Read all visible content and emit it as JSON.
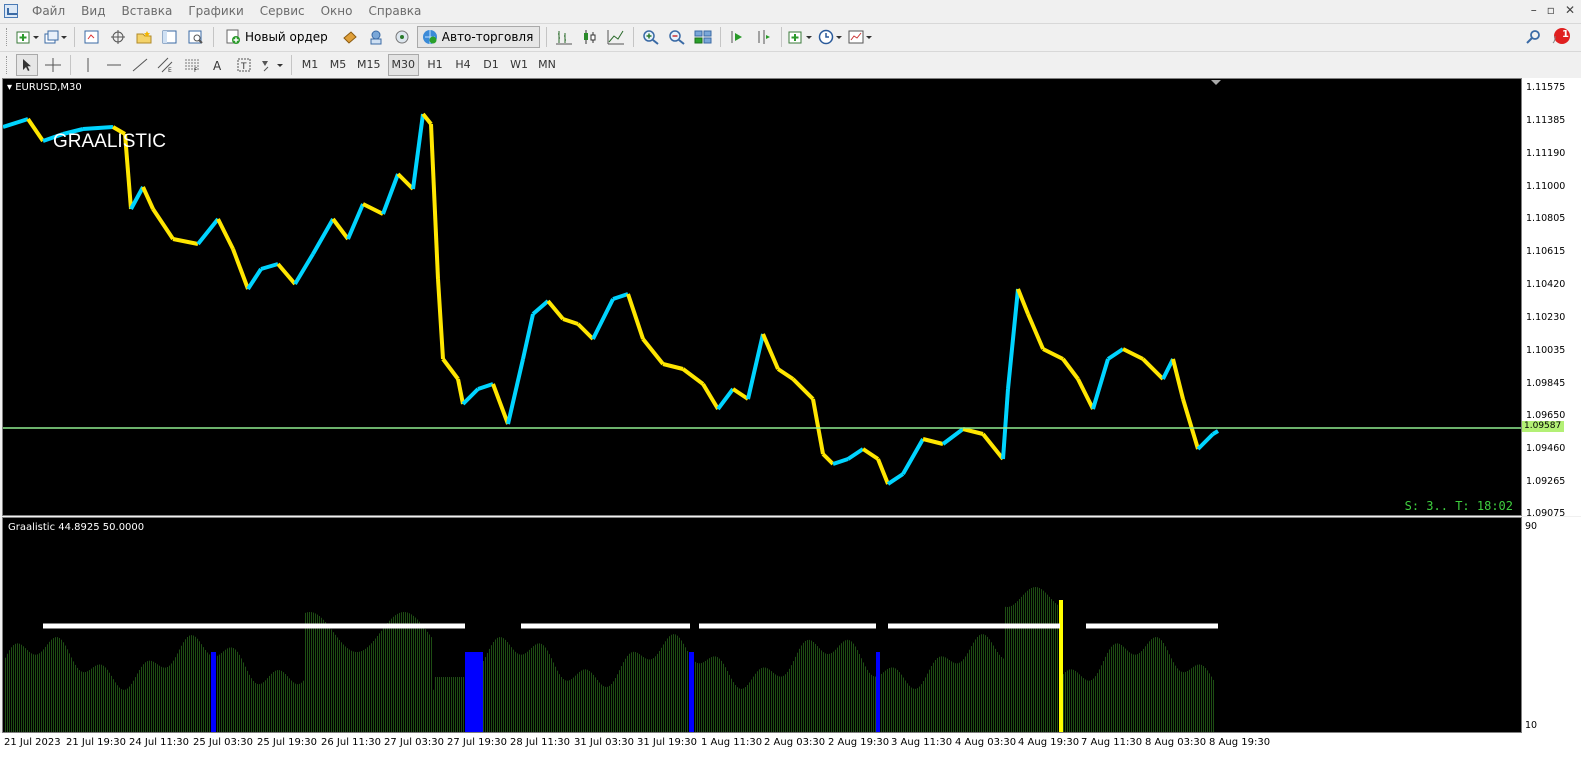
{
  "menu": {
    "items": [
      "Файл",
      "Вид",
      "Вставка",
      "Графики",
      "Сервис",
      "Окно",
      "Справка"
    ]
  },
  "window_controls": [
    "–",
    "▫",
    "✕"
  ],
  "toolbar": {
    "new_order_label": "Новый ордер",
    "auto_trading_label": "Авто-торговля",
    "notification_count": "1"
  },
  "timeframes": [
    "M1",
    "M5",
    "M15",
    "M30",
    "H1",
    "H4",
    "D1",
    "W1",
    "MN"
  ],
  "active_timeframe": "M30",
  "chart": {
    "symbol_label": "EURUSD,M30",
    "watermark": "GRAALISTIC",
    "status_text": "S: 3.. T: 18:02",
    "current_price": "1.09587",
    "price_ticks": [
      "1.11575",
      "1.11385",
      "1.11190",
      "1.11000",
      "1.10805",
      "1.10615",
      "1.10420",
      "1.10230",
      "1.10035",
      "1.09845",
      "1.09650",
      "1.09460",
      "1.09265",
      "1.09075"
    ],
    "colors": {
      "bull": "#00d4ff",
      "bear": "#ffe600",
      "level_line": "#90ee90"
    }
  },
  "indicator": {
    "label": "Graalistic 44.8925 50.0000",
    "ticks": [
      "90",
      "10"
    ],
    "colors": {
      "bars": "#1e4d14",
      "signal_blue": "#0000ff",
      "signal_yellow": "#ffff00",
      "levels": "#ffffff"
    }
  },
  "time_axis": [
    "21 Jul 2023",
    "21 Jul 19:30",
    "24 Jul 11:30",
    "25 Jul 03:30",
    "25 Jul 19:30",
    "26 Jul 11:30",
    "27 Jul 03:30",
    "27 Jul 19:30",
    "28 Jul 11:30",
    "31 Jul 03:30",
    "31 Jul 19:30",
    "1 Aug 11:30",
    "2 Aug 03:30",
    "2 Aug 19:30",
    "3 Aug 11:30",
    "4 Aug 03:30",
    "4 Aug 19:30",
    "7 Aug 11:30",
    "8 Aug 03:30",
    "8 Aug 19:30"
  ]
}
